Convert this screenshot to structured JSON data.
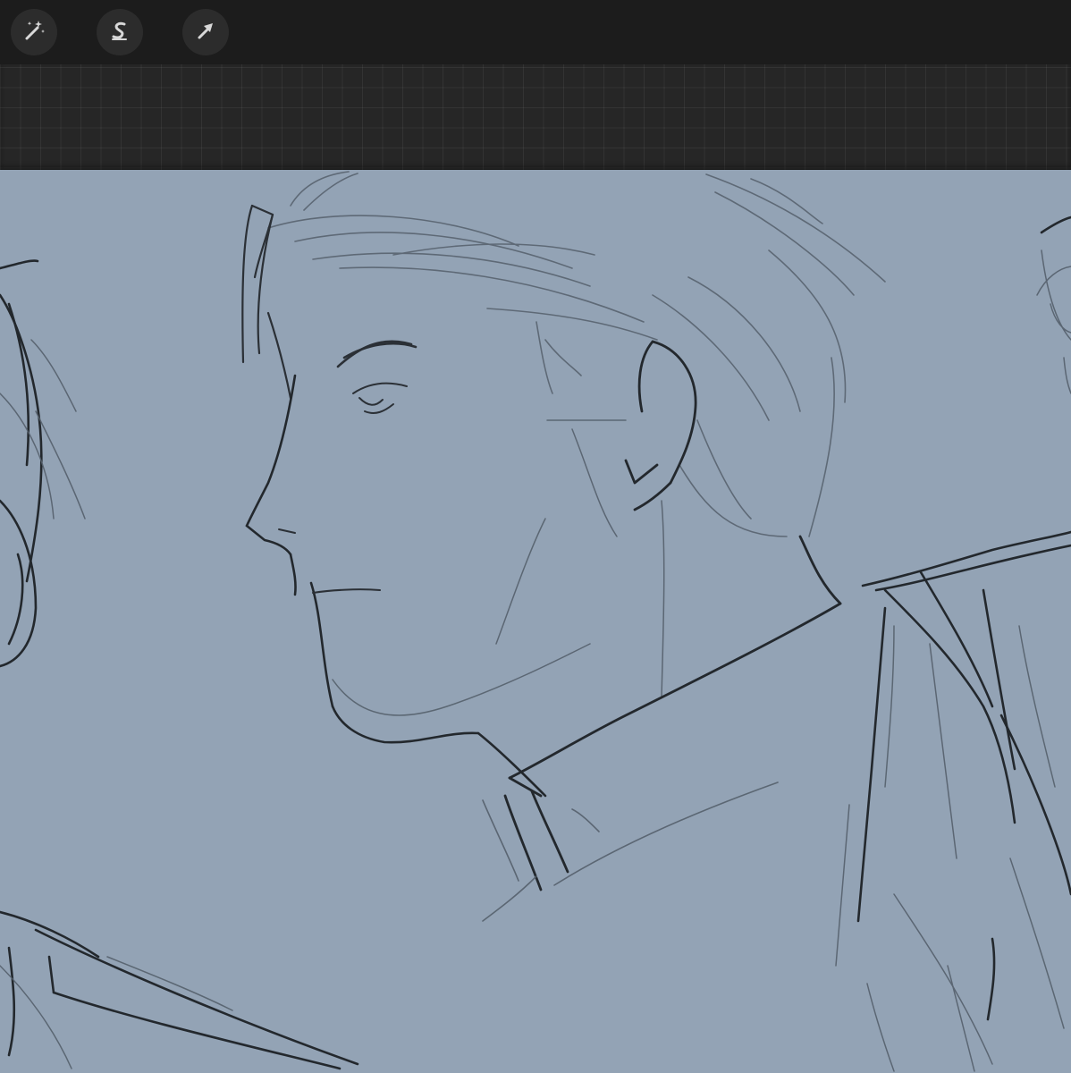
{
  "toolbar": {
    "tools": [
      {
        "name": "adjustments",
        "icon": "magic-wand-icon",
        "active": false
      },
      {
        "name": "selection",
        "icon": "selection-s-icon",
        "active": false
      },
      {
        "name": "transform",
        "icon": "arrow-cursor-icon",
        "active": false
      }
    ],
    "colors": {
      "bar": "#1c1c1c",
      "button": "#2c2c2c",
      "icon": "#d8d8d8"
    }
  },
  "canvas": {
    "background_color": "#93a3b5",
    "content": "sketch-drawing"
  }
}
